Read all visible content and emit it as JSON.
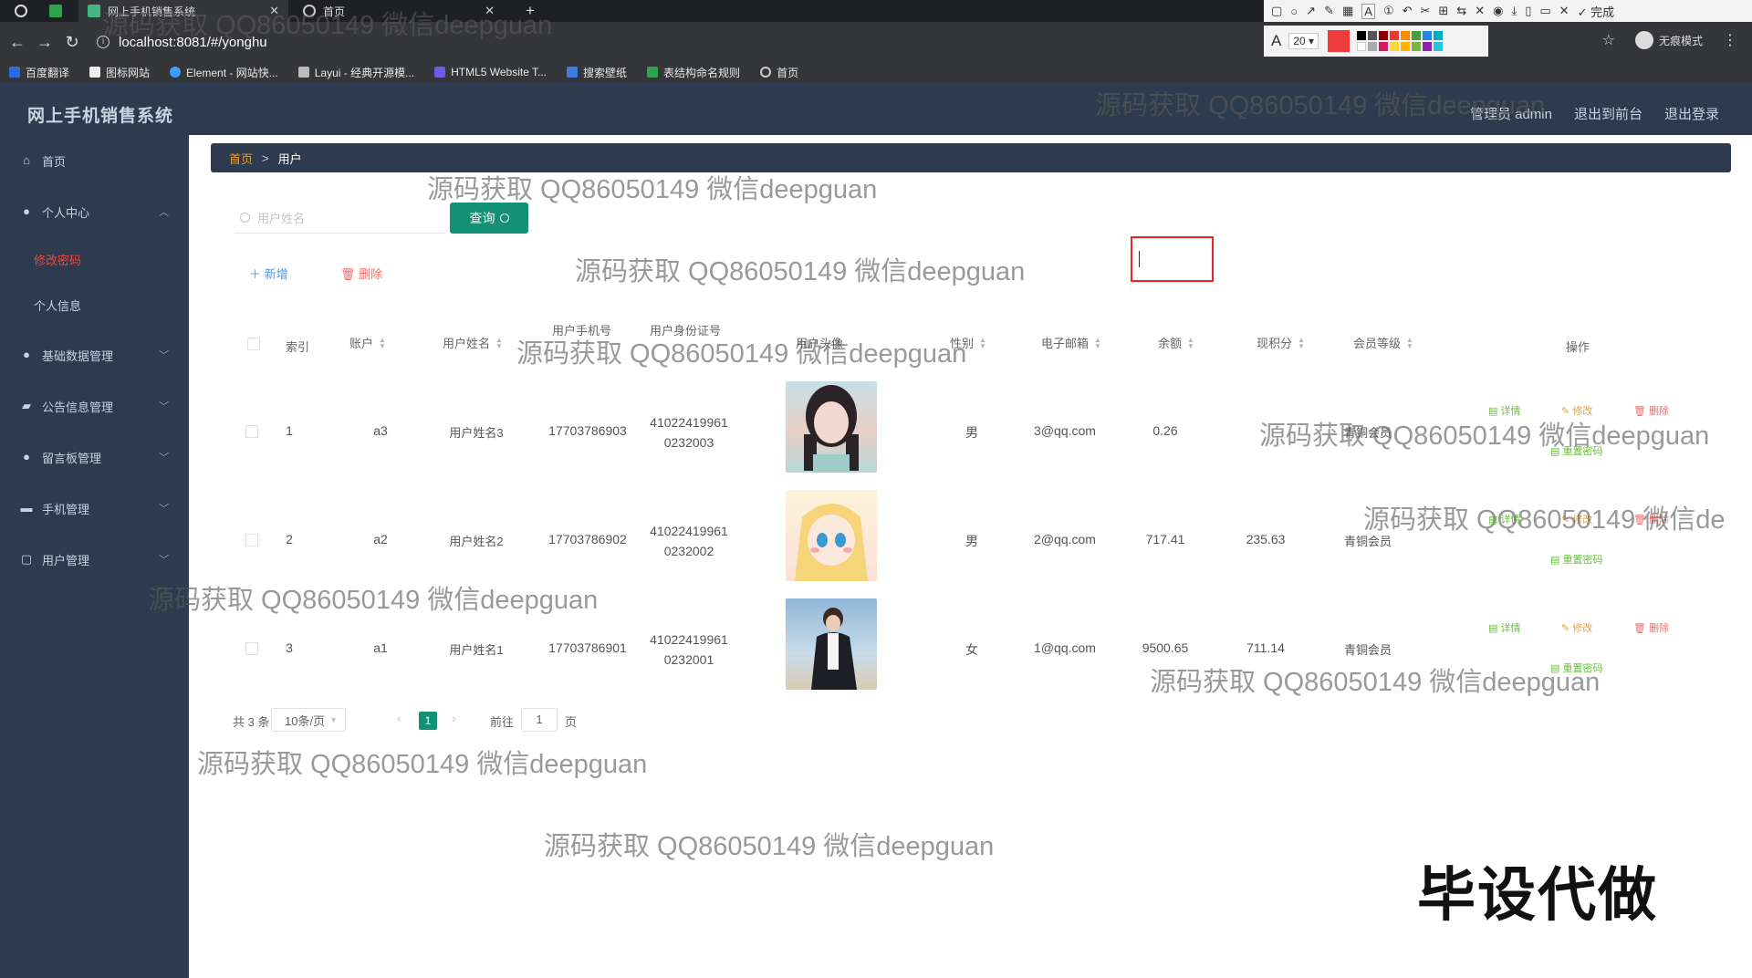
{
  "browser": {
    "tabs": [
      {
        "title": "网上手机销售系统"
      },
      {
        "title": "首页"
      }
    ],
    "url": "localhost:8081/#/yonghu",
    "bookmarks": [
      "百度翻译",
      "图标网站",
      "Element - 网站快...",
      "Layui - 经典开源模...",
      "HTML5 Website T...",
      "搜索壁纸",
      "表结构命名规则",
      "首页"
    ],
    "incognito_label": "无痕模式",
    "anno_size": "20",
    "anno_done": "完成",
    "colors": {
      "chrome_dark": "#1f2023",
      "chrome": "#35363a"
    }
  },
  "app": {
    "title": "网上手机销售系统",
    "header_links": [
      "管理员 admin",
      "退出到前台",
      "退出登录"
    ],
    "colors": {
      "navy": "#2e3a4e",
      "accent_green": "#129177",
      "active_red": "#e8483c"
    }
  },
  "sidebar": {
    "items": [
      {
        "label": "首页",
        "icon": "home-icon"
      },
      {
        "label": "个人中心",
        "icon": "user-icon"
      },
      {
        "label": "基础数据管理",
        "icon": "user-icon"
      },
      {
        "label": "公告信息管理",
        "icon": "message-icon"
      },
      {
        "label": "留言板管理",
        "icon": "user-icon"
      },
      {
        "label": "手机管理",
        "icon": "phone-icon"
      },
      {
        "label": "用户管理",
        "icon": "document-icon"
      }
    ],
    "sub_items": [
      {
        "label": "修改密码",
        "active": true
      },
      {
        "label": "个人信息",
        "active": false
      }
    ]
  },
  "breadcrumb": {
    "home": "首页",
    "sep": ">",
    "current": "用户"
  },
  "search": {
    "placeholder": "用户姓名",
    "button": "查询"
  },
  "actions": {
    "add": "新增",
    "delete": "删除"
  },
  "table": {
    "headers": [
      "索引",
      "账户",
      "用户姓名",
      "用户手机号",
      "用户身份证号",
      "用户头像",
      "性别",
      "电子邮箱",
      "余额",
      "现积分",
      "会员等级",
      "操作"
    ],
    "rows": [
      {
        "index": "1",
        "account": "a3",
        "name": "用户姓名3",
        "phone": "17703786903",
        "id_line1": "41022419961",
        "id_line2": "0232003",
        "gender": "男",
        "email": "3@qq.com",
        "balance": "0.26",
        "points": "",
        "level": "青铜会员"
      },
      {
        "index": "2",
        "account": "a2",
        "name": "用户姓名2",
        "phone": "17703786902",
        "id_line1": "41022419961",
        "id_line2": "0232002",
        "gender": "男",
        "email": "2@qq.com",
        "balance": "717.41",
        "points": "235.63",
        "level": "青铜会员"
      },
      {
        "index": "3",
        "account": "a1",
        "name": "用户姓名1",
        "phone": "17703786901",
        "id_line1": "41022419961",
        "id_line2": "0232001",
        "gender": "女",
        "email": "1@qq.com",
        "balance": "9500.65",
        "points": "711.14",
        "level": "青铜会员"
      }
    ],
    "ops": {
      "detail": "详情",
      "edit": "修改",
      "delete": "删除",
      "reset": "重置密码"
    }
  },
  "pager": {
    "total": "共 3 条",
    "size": "10条/页",
    "current": "1",
    "goto": "前往",
    "goto_value": "1",
    "page": "页"
  },
  "watermark": "源码获取 QQ86050149 微信deepguan",
  "watermark_cut": "源码获取 QQ86050149 微信de",
  "big_mark": "毕设代做"
}
